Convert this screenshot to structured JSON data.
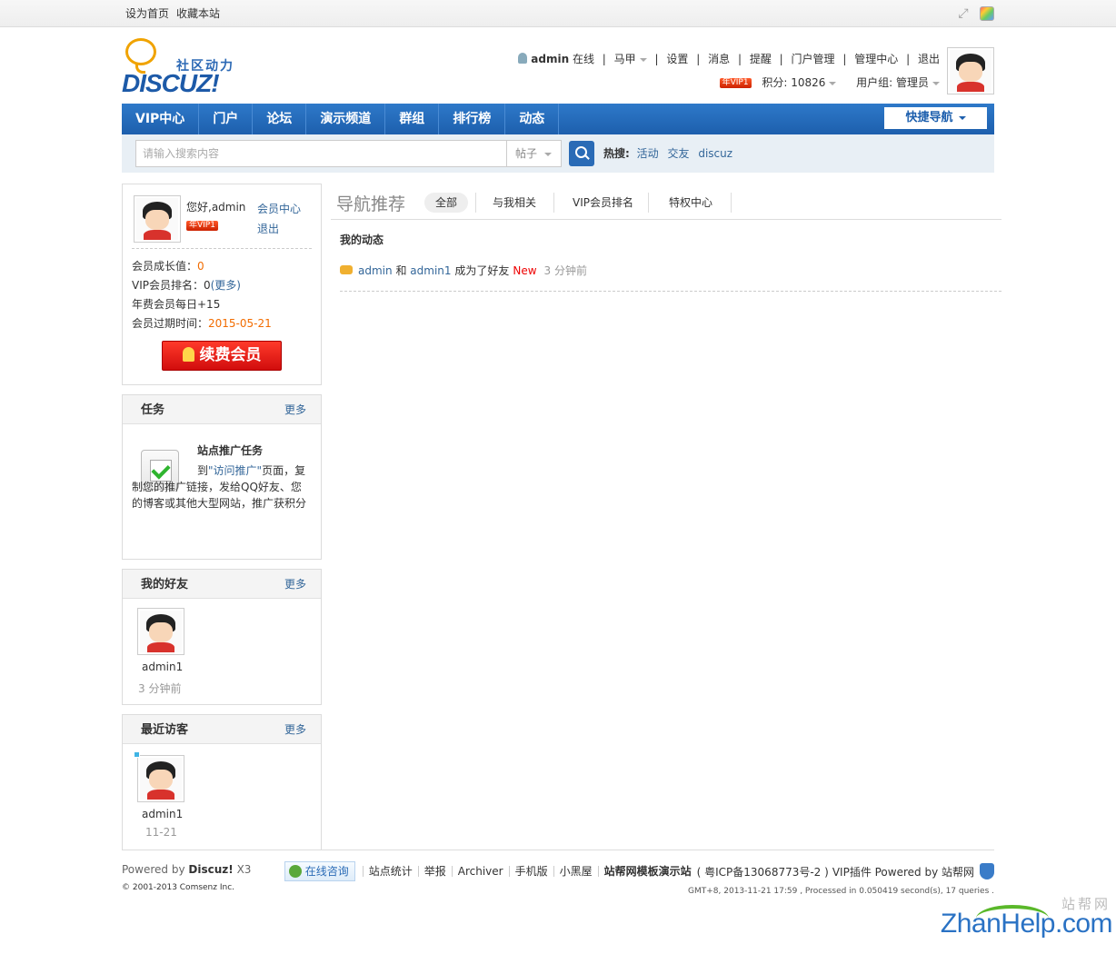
{
  "topbar": {
    "set_home": "设为首页",
    "bookmark": "收藏本站"
  },
  "logo": {
    "cn": "社区动力",
    "en": "DISCUZ!"
  },
  "userbar": {
    "username": "admin",
    "status": "在线",
    "majia": "马甲",
    "settings": "设置",
    "messages": "消息",
    "reminders": "提醒",
    "portal_admin": "门户管理",
    "admin_center": "管理中心",
    "logout": "退出",
    "vip_badge": "年VIP1",
    "points": "积分: 10826",
    "usergroup": "用户组: 管理员"
  },
  "nav": {
    "items": [
      "VIP中心",
      "门户",
      "论坛",
      "演示频道",
      "群组",
      "排行榜",
      "动态"
    ],
    "quicknav": "快捷导航"
  },
  "search": {
    "placeholder": "请输入搜索内容",
    "type": "帖子",
    "hot_label": "热搜:",
    "hot_keywords": [
      "活动",
      "交友",
      "discuz"
    ]
  },
  "profile": {
    "hello": "您好,admin",
    "vip_badge": "年VIP1",
    "member_center": "会员中心",
    "logout": "退出",
    "growth_label": "会员成长值：",
    "growth_value": "0",
    "rank_label": "VIP会员排名：0",
    "rank_more": "(更多)",
    "daily": "年费会员每日+15",
    "expire_label": "会员过期时间：",
    "expire_value": "2015-05-21",
    "renew_button": "续费会员"
  },
  "task_box": {
    "title": "任务",
    "more": "更多",
    "task_title": "站点推广任务",
    "desc_pre": "到",
    "desc_link": "\"访问推广\"",
    "desc_post": "页面，复制您的推广链接，发给QQ好友、您的博客或其他大型网站，推广获积分"
  },
  "friends_box": {
    "title": "我的好友",
    "more": "更多",
    "name": "admin1",
    "time": "3 分钟前"
  },
  "visitors_box": {
    "title": "最近访客",
    "more": "更多",
    "name": "admin1",
    "time": "11-21"
  },
  "feed": {
    "title": "导航推荐",
    "tabs": [
      "全部",
      "与我相关",
      "VIP会员排名",
      "特权中心"
    ],
    "section_title": "我的动态",
    "item": {
      "user1": "admin",
      "and": "和",
      "user2": "admin1",
      "action": "成为了好友",
      "new": "New",
      "time": "3 分钟前"
    }
  },
  "footer": {
    "powered_pre": "Powered by",
    "powered_brand": "Discuz!",
    "powered_ver": "X3",
    "copyright": "© 2001-2013 Comsenz Inc.",
    "consult": "在线咨询",
    "links": [
      "站点统计",
      "举报",
      "Archiver",
      "手机版",
      "小黑屋"
    ],
    "site_name": "站帮网模板演示站",
    "icp": "( 粤ICP备13068773号-2 )",
    "vip_plugin": "VIP插件 Powered by 站帮网",
    "debug": "GMT+8, 2013-11-21 17:59 , Processed in 0.050419 second(s), 17 queries ."
  },
  "watermark": {
    "cn": "站帮网",
    "en": "ZhanHelp.com"
  }
}
